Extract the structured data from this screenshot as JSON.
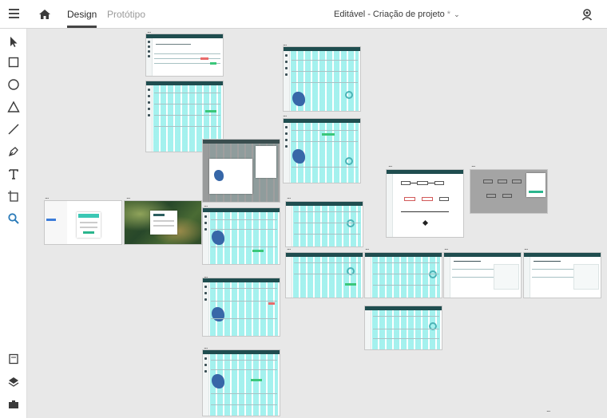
{
  "topbar": {
    "menu_icon": "hamburger-menu-icon",
    "home_icon": "home-icon",
    "tabs": [
      {
        "label": "Design",
        "active": true
      },
      {
        "label": "Protótipo",
        "active": false
      }
    ],
    "document_title": "Editável - Criação de projeto",
    "unsaved_marker": "*",
    "user_icon": "user-account-icon"
  },
  "tools": [
    {
      "name": "select-tool",
      "icon": "arrow-pointer-icon"
    },
    {
      "name": "rectangle-tool",
      "icon": "rectangle-icon"
    },
    {
      "name": "ellipse-tool",
      "icon": "circle-icon"
    },
    {
      "name": "triangle-tool",
      "icon": "triangle-icon"
    },
    {
      "name": "line-tool",
      "icon": "line-icon"
    },
    {
      "name": "pen-tool",
      "icon": "pen-icon"
    },
    {
      "name": "text-tool",
      "icon": "text-icon"
    },
    {
      "name": "artboard-tool",
      "icon": "artboard-icon"
    },
    {
      "name": "zoom-tool",
      "icon": "magnifier-icon",
      "active": true
    }
  ],
  "bottom_tools": [
    {
      "name": "assets-panel",
      "icon": "document-icon"
    },
    {
      "name": "layers-panel",
      "icon": "layers-icon"
    },
    {
      "name": "plugins-panel",
      "icon": "plugins-icon"
    }
  ],
  "colors": {
    "accent_active_tool": "#2a7ab8",
    "artboard_header": "#1f4d4f",
    "grid_overlay": "#5ae6e1"
  },
  "artboard_label": "..."
}
